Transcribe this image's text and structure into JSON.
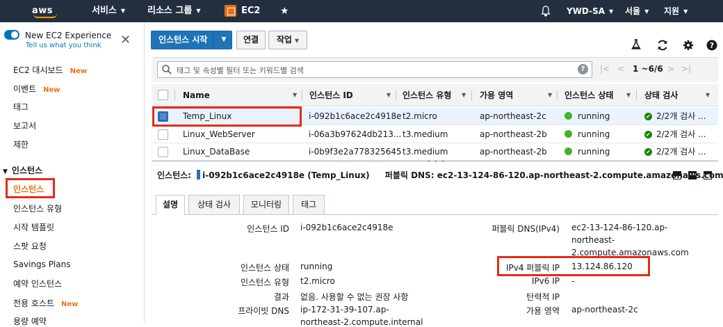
{
  "nav": {
    "logo": "aws",
    "services": "서비스",
    "resource_groups": "리소스 그룹",
    "service_name": "EC2",
    "account": "YWD-SA",
    "region": "서울",
    "support": "지원"
  },
  "sidebar": {
    "new_experience_title": "New EC2 Experience",
    "new_experience_link": "Tell us what you think",
    "new_badge": "New",
    "items": [
      {
        "label": "EC2 대시보드",
        "new": true
      },
      {
        "label": "이벤트",
        "new": true
      },
      {
        "label": "태그",
        "new": false
      },
      {
        "label": "보고서",
        "new": false
      },
      {
        "label": "제한",
        "new": false
      }
    ],
    "section_title": "인스턴스",
    "section_items": [
      {
        "label": "인스턴스",
        "new": false
      },
      {
        "label": "인스턴스 유형",
        "new": false
      },
      {
        "label": "시작 템플릿",
        "new": false
      },
      {
        "label": "스팟 요청",
        "new": false
      },
      {
        "label": "Savings Plans",
        "new": false
      },
      {
        "label": "예약 인스턴스",
        "new": false
      },
      {
        "label": "전용 호스트",
        "new": true
      },
      {
        "label": "용량 예약",
        "new": false
      }
    ]
  },
  "toolbar": {
    "launch": "인스턴스 시작",
    "connect": "연결",
    "actions": "작업"
  },
  "search": {
    "placeholder": "태그 및 속성별 필터 또는 키워드별 검색",
    "pagination": "1 ~6/6"
  },
  "table": {
    "columns": [
      "Name",
      "인스턴스 ID",
      "인스턴스 유형",
      "가용 영역",
      "인스턴스 상태",
      "상태 검사"
    ],
    "rows": [
      {
        "name": "Temp_Linux",
        "id": "i-092b1c6ace2c4918e",
        "type": "t2.micro",
        "az": "ap-northeast-2c",
        "state": "running",
        "check": "2/2개 검사 ...",
        "selected": true
      },
      {
        "name": "Linux_WebServer",
        "id": "i-06a3b97624db213...",
        "type": "t3.medium",
        "az": "ap-northeast-2b",
        "state": "running",
        "check": "2/2개 검사 ...",
        "selected": false
      },
      {
        "name": "Linux_DataBase",
        "id": "i-0b9f3e2a778325645",
        "type": "t3.medium",
        "az": "ap-northeast-2b",
        "state": "running",
        "check": "2/2개 검사 ...",
        "selected": false
      }
    ]
  },
  "detail": {
    "instance_label": "인스턴스:",
    "instance_value": "i-092b1c6ace2c4918e (Temp_Linux)",
    "dns_label": "퍼블릭 DNS:",
    "dns_value": "ec2-13-124-86-120.ap-northeast-2.compute.amazonaws.com",
    "tabs": [
      "설명",
      "상태 검사",
      "모니터링",
      "태그"
    ],
    "left_fields": [
      {
        "label": "인스턴스 ID",
        "value": "i-092b1c6ace2c4918e"
      },
      {
        "label": "인스턴스 상태",
        "value": "running"
      },
      {
        "label": "인스턴스 유형",
        "value": "t2.micro"
      },
      {
        "label": "결과",
        "value": "없음. 사용할 수 없는 권장 사항"
      },
      {
        "label": "프라이빗 DNS",
        "value": "ip-172-31-39-107.ap-"
      },
      {
        "label": "",
        "value": "northeast-2.compute.internal"
      }
    ],
    "right_fields": [
      {
        "label": "퍼블릭 DNS(IPv4)",
        "value": "ec2-13-124-86-120.ap-"
      },
      {
        "label": "",
        "value": "northeast-"
      },
      {
        "label": "",
        "value": "2.compute.amazonaws.com"
      },
      {
        "label": "IPv4 퍼블릭 IP",
        "value": "13.124.86.120"
      },
      {
        "label": "IPv6 IP",
        "value": "-"
      },
      {
        "label": "탄력적 IP",
        "value": ""
      },
      {
        "label": "가용 영역",
        "value": "ap-northeast-2c"
      }
    ]
  },
  "colors": {
    "nav_bg": "#232f3e",
    "primary": "#1f73b7",
    "highlight": "#e8281b",
    "running": "#45b12a",
    "new_badge": "#ec7211"
  }
}
